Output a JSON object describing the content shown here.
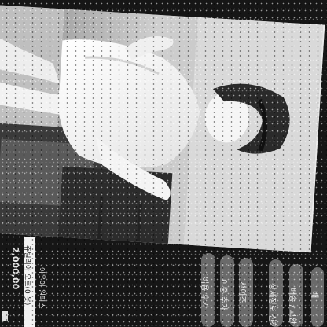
{
  "price": {
    "amount": "2,000,00",
    "line1": "쥬빌리아 오르(0 옷)",
    "line2": "아웃이 원피스"
  },
  "chips": [
    {
      "label": "이용 후기"
    },
    {
      "label": "이중 추가"
    },
    {
      "label": "사이즈"
    },
    {
      "label": "상세정보 신청"
    },
    {
      "label": "배송 / 교환"
    },
    {
      "label": "배"
    }
  ],
  "icons": {
    "photo": "model-photo",
    "bookmark": "bookmark-icon"
  }
}
